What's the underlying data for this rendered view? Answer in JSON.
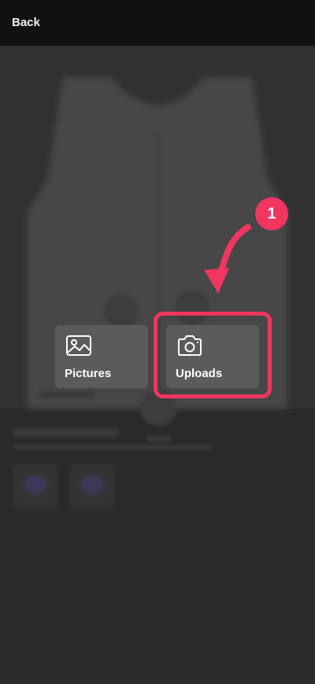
{
  "header": {
    "back_label": "Back"
  },
  "upload_options": [
    {
      "label": "Pictures",
      "icon": "image-icon"
    },
    {
      "label": "Uploads",
      "icon": "camera-icon"
    }
  ],
  "annotation": {
    "step_number": "1",
    "accent_color": "#f0365f"
  }
}
